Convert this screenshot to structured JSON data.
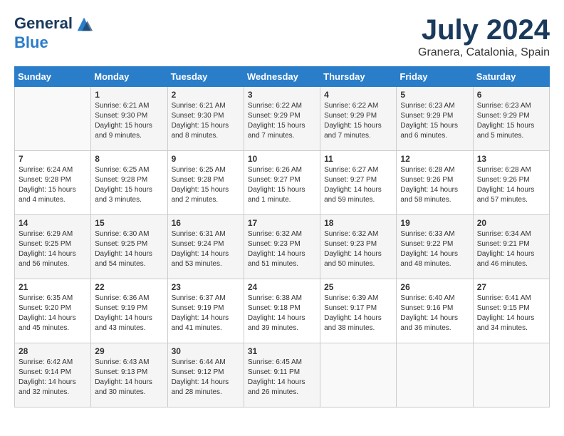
{
  "header": {
    "logo_line1": "General",
    "logo_line2": "Blue",
    "month": "July 2024",
    "location": "Granera, Catalonia, Spain"
  },
  "days_of_week": [
    "Sunday",
    "Monday",
    "Tuesday",
    "Wednesday",
    "Thursday",
    "Friday",
    "Saturday"
  ],
  "weeks": [
    [
      {
        "day": "",
        "content": ""
      },
      {
        "day": "1",
        "content": "Sunrise: 6:21 AM\nSunset: 9:30 PM\nDaylight: 15 hours\nand 9 minutes."
      },
      {
        "day": "2",
        "content": "Sunrise: 6:21 AM\nSunset: 9:30 PM\nDaylight: 15 hours\nand 8 minutes."
      },
      {
        "day": "3",
        "content": "Sunrise: 6:22 AM\nSunset: 9:29 PM\nDaylight: 15 hours\nand 7 minutes."
      },
      {
        "day": "4",
        "content": "Sunrise: 6:22 AM\nSunset: 9:29 PM\nDaylight: 15 hours\nand 7 minutes."
      },
      {
        "day": "5",
        "content": "Sunrise: 6:23 AM\nSunset: 9:29 PM\nDaylight: 15 hours\nand 6 minutes."
      },
      {
        "day": "6",
        "content": "Sunrise: 6:23 AM\nSunset: 9:29 PM\nDaylight: 15 hours\nand 5 minutes."
      }
    ],
    [
      {
        "day": "7",
        "content": "Sunrise: 6:24 AM\nSunset: 9:28 PM\nDaylight: 15 hours\nand 4 minutes."
      },
      {
        "day": "8",
        "content": "Sunrise: 6:25 AM\nSunset: 9:28 PM\nDaylight: 15 hours\nand 3 minutes."
      },
      {
        "day": "9",
        "content": "Sunrise: 6:25 AM\nSunset: 9:28 PM\nDaylight: 15 hours\nand 2 minutes."
      },
      {
        "day": "10",
        "content": "Sunrise: 6:26 AM\nSunset: 9:27 PM\nDaylight: 15 hours\nand 1 minute."
      },
      {
        "day": "11",
        "content": "Sunrise: 6:27 AM\nSunset: 9:27 PM\nDaylight: 14 hours\nand 59 minutes."
      },
      {
        "day": "12",
        "content": "Sunrise: 6:28 AM\nSunset: 9:26 PM\nDaylight: 14 hours\nand 58 minutes."
      },
      {
        "day": "13",
        "content": "Sunrise: 6:28 AM\nSunset: 9:26 PM\nDaylight: 14 hours\nand 57 minutes."
      }
    ],
    [
      {
        "day": "14",
        "content": "Sunrise: 6:29 AM\nSunset: 9:25 PM\nDaylight: 14 hours\nand 56 minutes."
      },
      {
        "day": "15",
        "content": "Sunrise: 6:30 AM\nSunset: 9:25 PM\nDaylight: 14 hours\nand 54 minutes."
      },
      {
        "day": "16",
        "content": "Sunrise: 6:31 AM\nSunset: 9:24 PM\nDaylight: 14 hours\nand 53 minutes."
      },
      {
        "day": "17",
        "content": "Sunrise: 6:32 AM\nSunset: 9:23 PM\nDaylight: 14 hours\nand 51 minutes."
      },
      {
        "day": "18",
        "content": "Sunrise: 6:32 AM\nSunset: 9:23 PM\nDaylight: 14 hours\nand 50 minutes."
      },
      {
        "day": "19",
        "content": "Sunrise: 6:33 AM\nSunset: 9:22 PM\nDaylight: 14 hours\nand 48 minutes."
      },
      {
        "day": "20",
        "content": "Sunrise: 6:34 AM\nSunset: 9:21 PM\nDaylight: 14 hours\nand 46 minutes."
      }
    ],
    [
      {
        "day": "21",
        "content": "Sunrise: 6:35 AM\nSunset: 9:20 PM\nDaylight: 14 hours\nand 45 minutes."
      },
      {
        "day": "22",
        "content": "Sunrise: 6:36 AM\nSunset: 9:19 PM\nDaylight: 14 hours\nand 43 minutes."
      },
      {
        "day": "23",
        "content": "Sunrise: 6:37 AM\nSunset: 9:19 PM\nDaylight: 14 hours\nand 41 minutes."
      },
      {
        "day": "24",
        "content": "Sunrise: 6:38 AM\nSunset: 9:18 PM\nDaylight: 14 hours\nand 39 minutes."
      },
      {
        "day": "25",
        "content": "Sunrise: 6:39 AM\nSunset: 9:17 PM\nDaylight: 14 hours\nand 38 minutes."
      },
      {
        "day": "26",
        "content": "Sunrise: 6:40 AM\nSunset: 9:16 PM\nDaylight: 14 hours\nand 36 minutes."
      },
      {
        "day": "27",
        "content": "Sunrise: 6:41 AM\nSunset: 9:15 PM\nDaylight: 14 hours\nand 34 minutes."
      }
    ],
    [
      {
        "day": "28",
        "content": "Sunrise: 6:42 AM\nSunset: 9:14 PM\nDaylight: 14 hours\nand 32 minutes."
      },
      {
        "day": "29",
        "content": "Sunrise: 6:43 AM\nSunset: 9:13 PM\nDaylight: 14 hours\nand 30 minutes."
      },
      {
        "day": "30",
        "content": "Sunrise: 6:44 AM\nSunset: 9:12 PM\nDaylight: 14 hours\nand 28 minutes."
      },
      {
        "day": "31",
        "content": "Sunrise: 6:45 AM\nSunset: 9:11 PM\nDaylight: 14 hours\nand 26 minutes."
      },
      {
        "day": "",
        "content": ""
      },
      {
        "day": "",
        "content": ""
      },
      {
        "day": "",
        "content": ""
      }
    ]
  ]
}
